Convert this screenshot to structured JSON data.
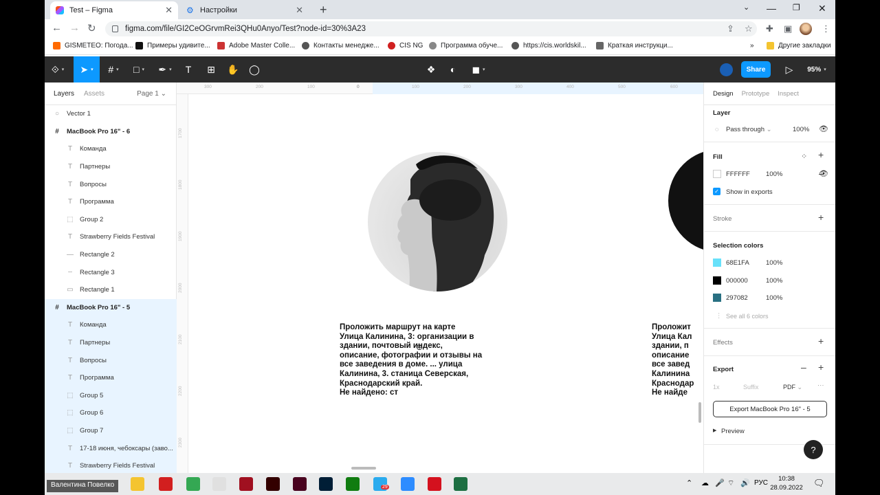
{
  "browser": {
    "tabs": [
      {
        "title": "Test – Figma"
      },
      {
        "title": "Настройки"
      }
    ],
    "url": "figma.com/file/GI2CeOGrvmRei3QHu0Anyo/Test?node-id=30%3A23",
    "bookmarks": [
      {
        "label": "GISMETEO: Погода...",
        "color": "#ff6a00"
      },
      {
        "label": "Примеры удивите...",
        "color": "#111111"
      },
      {
        "label": "Adobe Master Colle...",
        "color": "#cc3333"
      },
      {
        "label": "Контакты менедже...",
        "color": "#555555"
      },
      {
        "label": "CIS NG",
        "color": "#d02020"
      },
      {
        "label": "Программа обуче...",
        "color": "#888888"
      },
      {
        "label": "https://cis.worldskil...",
        "color": "#555555"
      },
      {
        "label": "Краткая инструкци...",
        "color": "#666666"
      }
    ],
    "other_bookmarks": "Другие закладки"
  },
  "figma": {
    "zoom": "95%",
    "share_label": "Share",
    "left_tabs": [
      "Layers",
      "Assets"
    ],
    "page_label": "Page 1",
    "layers": [
      {
        "name": "Vector 1",
        "icon": "vector-icon",
        "glyph": "○",
        "frame": false,
        "selected": false,
        "indent": 0
      },
      {
        "name": "MacBook Pro 16\" - 6",
        "icon": "frame-icon",
        "glyph": "#",
        "frame": true,
        "selected": false,
        "indent": 0
      },
      {
        "name": "Команда",
        "icon": "text-icon",
        "glyph": "T",
        "frame": false,
        "selected": false,
        "indent": 1
      },
      {
        "name": "Партнеры",
        "icon": "text-icon",
        "glyph": "T",
        "frame": false,
        "selected": false,
        "indent": 1
      },
      {
        "name": "Вопросы",
        "icon": "text-icon",
        "glyph": "T",
        "frame": false,
        "selected": false,
        "indent": 1
      },
      {
        "name": "Программа",
        "icon": "text-icon",
        "glyph": "T",
        "frame": false,
        "selected": false,
        "indent": 1
      },
      {
        "name": "Group 2",
        "icon": "group-icon",
        "glyph": "⬚",
        "frame": false,
        "selected": false,
        "indent": 1
      },
      {
        "name": "Strawberry Fields Festival",
        "icon": "text-icon",
        "glyph": "T",
        "frame": false,
        "selected": false,
        "indent": 1
      },
      {
        "name": "Rectangle 2",
        "icon": "line-icon",
        "glyph": "—",
        "frame": false,
        "selected": false,
        "indent": 1
      },
      {
        "name": "Rectangle 3",
        "icon": "dotted-rect-icon",
        "glyph": "┄",
        "frame": false,
        "selected": false,
        "indent": 1
      },
      {
        "name": "Rectangle 1",
        "icon": "rectangle-icon",
        "glyph": "▭",
        "frame": false,
        "selected": false,
        "indent": 1
      },
      {
        "name": "MacBook Pro 16\" - 5",
        "icon": "frame-icon",
        "glyph": "#",
        "frame": true,
        "selected": true,
        "indent": 0
      },
      {
        "name": "Команда",
        "icon": "text-icon",
        "glyph": "T",
        "frame": false,
        "selected": true,
        "indent": 1
      },
      {
        "name": "Партнеры",
        "icon": "text-icon",
        "glyph": "T",
        "frame": false,
        "selected": true,
        "indent": 1
      },
      {
        "name": "Вопросы",
        "icon": "text-icon",
        "glyph": "T",
        "frame": false,
        "selected": true,
        "indent": 1
      },
      {
        "name": "Программа",
        "icon": "text-icon",
        "glyph": "T",
        "frame": false,
        "selected": true,
        "indent": 1
      },
      {
        "name": "Group 5",
        "icon": "group-icon",
        "glyph": "⬚",
        "frame": false,
        "selected": true,
        "indent": 1
      },
      {
        "name": "Group 6",
        "icon": "group-icon",
        "glyph": "⬚",
        "frame": false,
        "selected": true,
        "indent": 1
      },
      {
        "name": "Group 7",
        "icon": "group-icon",
        "glyph": "⬚",
        "frame": false,
        "selected": true,
        "indent": 1
      },
      {
        "name": "17-18 июня, чебоксары (заво...",
        "icon": "text-icon",
        "glyph": "T",
        "frame": false,
        "selected": true,
        "indent": 1
      },
      {
        "name": "Strawberry Fields Festival",
        "icon": "text-icon",
        "glyph": "T",
        "frame": false,
        "selected": true,
        "indent": 1
      }
    ],
    "ruler_top": [
      "300",
      "200",
      "100",
      "0",
      "100",
      "200",
      "300",
      "400",
      "500",
      "600"
    ],
    "ruler_left": [
      "1700",
      "1800",
      "1900",
      "2000",
      "2100",
      "2200",
      "2300"
    ],
    "canvas_text": "Проложить маршрут на карте\nУлица Калинина, 3: организации в\nздании, почтовый индекс,\nописание, фотографии и отзывы на\nвсе заведения в доме. ... улица\nКалинина, 3. станица Северская,\nКраснодарский край.\nНе найдено: ст",
    "canvas_text_cut": "Проложит\nУлица Кал\nздании, п\nописание\nвсе завед\nКалинина\nКраснодар\nНе найде",
    "right_tabs": [
      "Design",
      "Prototype",
      "Inspect"
    ],
    "layer_section": {
      "title": "Layer",
      "blend": "Pass through",
      "opacity": "100%"
    },
    "fill": {
      "title": "Fill",
      "hex": "FFFFFF",
      "opacity": "100%",
      "show_in_exports": "Show in exports"
    },
    "stroke_title": "Stroke",
    "selection_colors": {
      "title": "Selection colors",
      "colors": [
        {
          "hex": "68E1FA",
          "opacity": "100%",
          "color": "#68E1FA"
        },
        {
          "hex": "000000",
          "opacity": "100%",
          "color": "#000000"
        },
        {
          "hex": "297082",
          "opacity": "100%",
          "color": "#297082"
        }
      ],
      "see_all": "See all 6 colors"
    },
    "effects_title": "Effects",
    "export": {
      "title": "Export",
      "scale": "1x",
      "suffix": "Suffix",
      "format": "PDF",
      "button": "Export MacBook Pro 16\" - 5",
      "preview": "Preview"
    },
    "help": "?"
  },
  "taskbar": {
    "user": "Валентина Повелко",
    "lang": "РУС",
    "time": "10:38",
    "date": "28.09.2022",
    "apps": [
      {
        "name": "file-explorer-icon",
        "color": "#f4c430"
      },
      {
        "name": "opera-icon",
        "color": "#d21f1f"
      },
      {
        "name": "chrome-icon",
        "color": "#34a853"
      },
      {
        "name": "vpn-icon",
        "color": "#e0e0e0"
      },
      {
        "name": "app-red-icon",
        "color": "#a01020"
      },
      {
        "name": "illustrator-icon",
        "color": "#330000"
      },
      {
        "name": "indesign-icon",
        "color": "#49021f"
      },
      {
        "name": "photoshop-icon",
        "color": "#001e36"
      },
      {
        "name": "xbox-icon",
        "color": "#107c10"
      },
      {
        "name": "telegram-icon",
        "color": "#2aabee"
      },
      {
        "name": "zoom-icon",
        "color": "#2d8cff"
      },
      {
        "name": "acrobat-icon",
        "color": "#d4111e"
      },
      {
        "name": "excel-icon",
        "color": "#1d6f42"
      }
    ],
    "badge": "29"
  }
}
